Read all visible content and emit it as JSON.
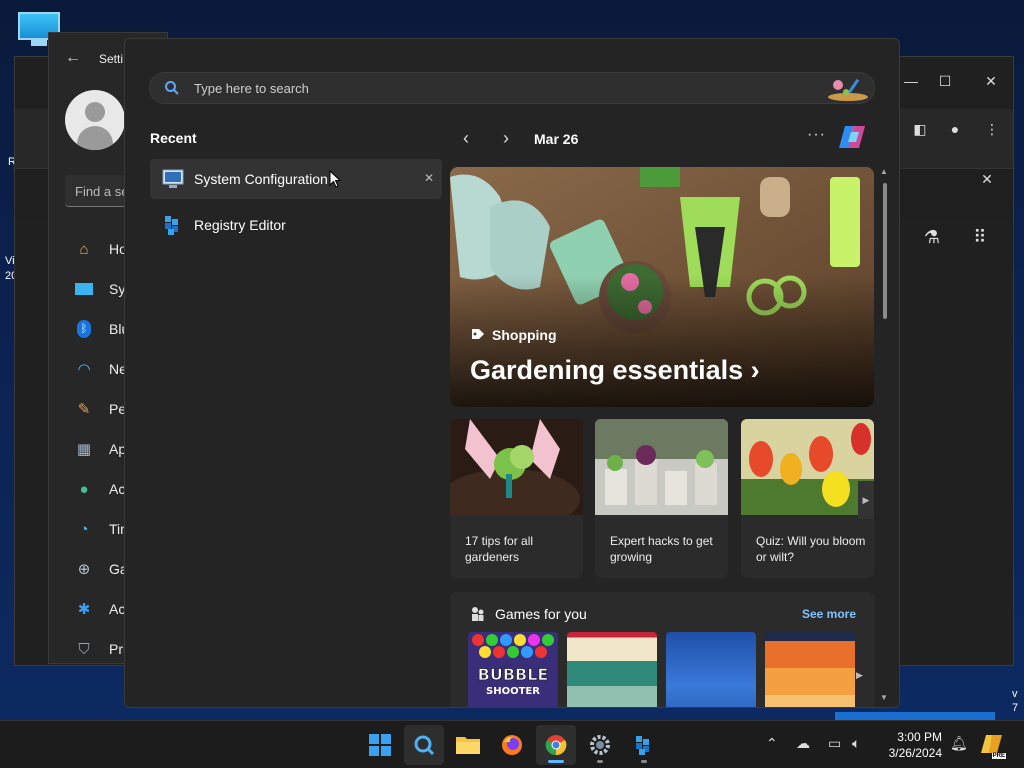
{
  "desktop": {
    "text_left_1": "R",
    "text_left_2": "Vi",
    "text_left_3": "20",
    "text_right_1": "v",
    "text_right_2": "7"
  },
  "settings": {
    "title": "Setti",
    "find_placeholder": "Find a se",
    "nav": [
      {
        "label": "Ho",
        "icon": "home-icon"
      },
      {
        "label": "Sys",
        "icon": "system-icon"
      },
      {
        "label": "Blu",
        "icon": "bluetooth-icon"
      },
      {
        "label": "Ne",
        "icon": "wifi-icon"
      },
      {
        "label": "Per",
        "icon": "brush-icon"
      },
      {
        "label": "Ap",
        "icon": "apps-icon"
      },
      {
        "label": "Ac",
        "icon": "accounts-icon"
      },
      {
        "label": "Tin",
        "icon": "time-icon"
      },
      {
        "label": "Ga",
        "icon": "gaming-icon"
      },
      {
        "label": "Ac",
        "icon": "accessibility-icon"
      },
      {
        "label": "Pri",
        "icon": "shield-icon"
      }
    ]
  },
  "start": {
    "search_placeholder": "Type here to search",
    "recent_heading": "Recent",
    "recent": [
      {
        "label": "System Configuration",
        "icon": "msconfig-icon"
      },
      {
        "label": "Registry Editor",
        "icon": "regedit-icon"
      }
    ],
    "date": "Mar 26",
    "hero": {
      "tag": "Shopping",
      "headline": "Gardening essentials"
    },
    "cards": [
      {
        "caption": "17 tips for all gardeners"
      },
      {
        "caption": "Expert hacks to get growing"
      },
      {
        "caption": "Quiz: Will you bloom or wilt?"
      }
    ],
    "games": {
      "title": "Games for you",
      "see_more": "See more",
      "tile1_text1": "BUBBLE",
      "tile1_text2": "SHOOTER"
    }
  },
  "taskbar": {
    "time": "3:00 PM",
    "date": "3/26/2024",
    "badge": "PRE"
  },
  "colors": {
    "accent": "#5cb8ff",
    "see_more": "#7fc4ff"
  }
}
